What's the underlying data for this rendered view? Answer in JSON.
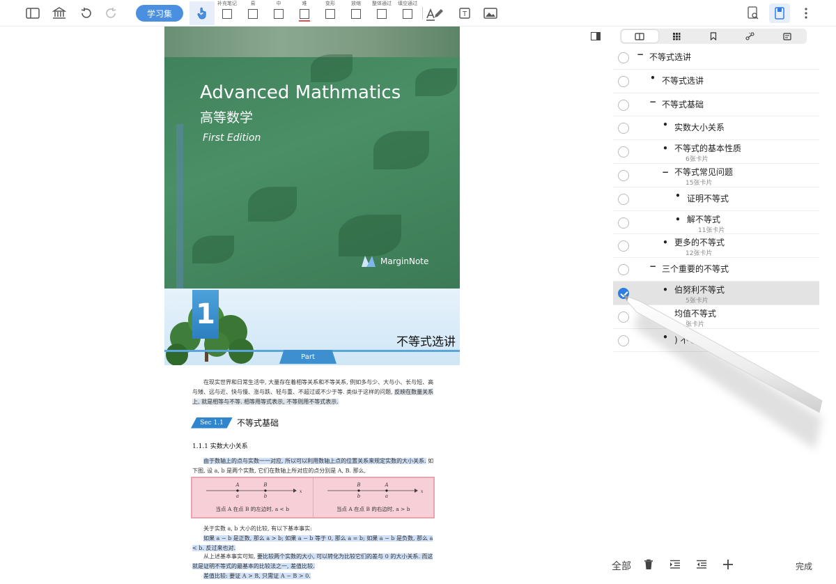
{
  "toolbar": {
    "study_set_label": "学习集",
    "tools": [
      {
        "label": "补充笔记",
        "bar": "#ffffff"
      },
      {
        "label": "易",
        "bar": "#ffffff"
      },
      {
        "label": "中",
        "bar": "#ffffff"
      },
      {
        "label": "难",
        "bar": "#e05050"
      },
      {
        "label": "变形",
        "bar": "#ffffff"
      },
      {
        "label": "放缩",
        "bar": "#ffffff"
      },
      {
        "label": "整体通过",
        "bar": "#ffffff"
      },
      {
        "label": "填空通过",
        "bar": "#ffffff"
      }
    ],
    "text_tool_glyph": "T",
    "colors": {
      "accent": "#4a8fe0"
    }
  },
  "document": {
    "cover": {
      "title_en": "Advanced Mathmatics",
      "title_zh": "高等数学",
      "edition": "First Edition",
      "brand": "MarginNote"
    },
    "chapter": {
      "number": "1",
      "title": "不等式选讲",
      "part_label": "Part"
    },
    "paragraphs": {
      "intro_plain": "在现实世界和日常生活中, 大量存在着相等关系和不等关系, 例如多与少、大与小、长与短、高与矮、远与近、快与慢、涨与跌、轻与重、不超过或不少于等. 类似于这样的问题, ",
      "intro_hl": "反映在数量关系上, 就是相等与不等. 相等用等式表示, 不等则用不等式表示.",
      "sec_badge": "Sec 1.1",
      "sec_title": "不等式基础",
      "subsec": "1.1.1   实数大小关系",
      "p2_hl": "由于数轴上的点与实数一一对应, 所以可以利用数轴上点的位置关系来规定实数的大小关系.",
      "p2_plain": " 如下图, 设 a, b 是两个实数, 它们在数轴上所对应的点分别是 A, B. 那么,",
      "fig_left": "当点 A 在点 B 的左边时, a < b",
      "fig_right": "当点 A 在点 B 的右边时, a > b",
      "p3_plain": "关于实数 a, b 大小的比较, 有以下基本事实:",
      "p3_hl": "如果 a − b 是正数, 那么 a > b; 如果 a − b 等于 0, 那么 a = b; 如果 a − b 是负数, 那么 a < b. 反过来也对.",
      "p4_plain": "从上述基本事实可知, ",
      "p4_hl": "要比较两个实数的大小, 可以转化为比较它们的差与 0 的大小关系. 而这就是证明不等式的最基本的比较法之一, 差值比较.",
      "p5_hl": "差值比较: 要证 A > B, 只需证 A − B > 0."
    }
  },
  "panel": {
    "tabs": [
      "book-icon",
      "grid-icon",
      "bookmark-icon",
      "mindmap-icon",
      "card-icon"
    ],
    "outline": [
      {
        "mark": "−",
        "level": 0,
        "label": "不等式选讲",
        "count": "",
        "checked": false
      },
      {
        "mark": "•",
        "level": 1,
        "label": "不等式选讲",
        "count": "",
        "checked": false
      },
      {
        "mark": "−",
        "level": 1,
        "label": "不等式基础",
        "count": "",
        "checked": false
      },
      {
        "mark": "•",
        "level": 2,
        "label": "实数大小关系",
        "count": "",
        "checked": false
      },
      {
        "mark": "•",
        "level": 2,
        "label": "不等式的基本性质",
        "count": "6张卡片",
        "checked": false
      },
      {
        "mark": "−",
        "level": 2,
        "label": "不等式常见问题",
        "count": "15张卡片",
        "checked": false
      },
      {
        "mark": "•",
        "level": 3,
        "label": "证明不等式",
        "count": "",
        "checked": false
      },
      {
        "mark": "•",
        "level": 3,
        "label": "解不等式",
        "count": "11张卡片",
        "checked": false
      },
      {
        "mark": "•",
        "level": 2,
        "label": "更多的不等式",
        "count": "12张卡片",
        "checked": false
      },
      {
        "mark": "−",
        "level": 1,
        "label": "三个重要的不等式",
        "count": "",
        "checked": false
      },
      {
        "mark": "•",
        "level": 2,
        "label": "伯努利不等式",
        "count": "5张卡片",
        "checked": true
      },
      {
        "mark": "",
        "level": 2,
        "label": "均值不等式",
        "count": "张卡片",
        "checked": false
      },
      {
        "mark": "•",
        "level": 2,
        "label": ") 不等式",
        "count": "",
        "checked": false
      }
    ]
  },
  "bottom": {
    "all_label": "全部",
    "done_label": "完成"
  }
}
